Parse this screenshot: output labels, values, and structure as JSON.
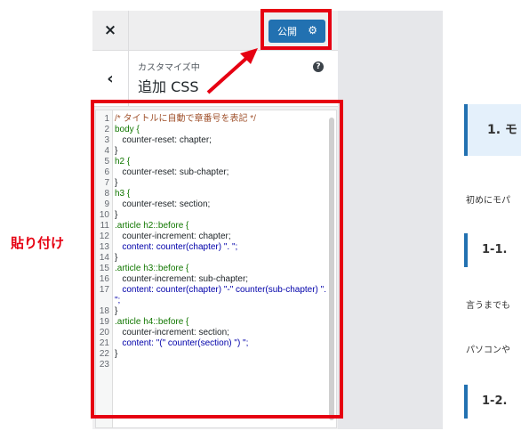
{
  "annotation": {
    "label": "貼り付け",
    "color": "#e60012"
  },
  "header": {
    "close_icon": "×",
    "publish_label": "公開",
    "settings_icon": "⚙"
  },
  "section": {
    "back_icon": "‹",
    "breadcrumb": "カスタマイズ中",
    "title": "追加 CSS",
    "help_icon": "?"
  },
  "editor": {
    "lines": [
      {
        "n": "1",
        "text": "/* タイトルに自動で章番号を表記 */",
        "type": "comment"
      },
      {
        "n": "2",
        "text": "body {",
        "type": "tag"
      },
      {
        "n": "3",
        "text": "   counter-reset: chapter;",
        "type": "plain"
      },
      {
        "n": "4",
        "text": "}",
        "type": "plain"
      },
      {
        "n": "5",
        "text": "h2 {",
        "type": "tag"
      },
      {
        "n": "6",
        "text": "   counter-reset: sub-chapter;",
        "type": "plain"
      },
      {
        "n": "7",
        "text": "}",
        "type": "plain"
      },
      {
        "n": "8",
        "text": "h3 {",
        "type": "tag"
      },
      {
        "n": "9",
        "text": "   counter-reset: section;",
        "type": "plain"
      },
      {
        "n": "10",
        "text": "}",
        "type": "plain"
      },
      {
        "n": "11",
        "text": ".article h2::before {",
        "type": "tag"
      },
      {
        "n": "12",
        "text": "   counter-increment: chapter;",
        "type": "plain"
      },
      {
        "n": "13",
        "text": "   content: counter(chapter) \". \";",
        "type": "fn"
      },
      {
        "n": "14",
        "text": "}",
        "type": "plain"
      },
      {
        "n": "15",
        "text": ".article h3::before {",
        "type": "tag"
      },
      {
        "n": "16",
        "text": "   counter-increment: sub-chapter;",
        "type": "plain"
      },
      {
        "n": "17",
        "text": "   content: counter(chapter) \"-\" counter(sub-chapter) \". \";",
        "type": "fn"
      },
      {
        "n": "18",
        "text": "}",
        "type": "plain"
      },
      {
        "n": "19",
        "text": ".article h4::before {",
        "type": "tag"
      },
      {
        "n": "20",
        "text": "   counter-increment: section;",
        "type": "plain"
      },
      {
        "n": "21",
        "text": "   content: \"(\" counter(section) \") \";",
        "type": "fn"
      },
      {
        "n": "22",
        "text": "}",
        "type": "plain"
      },
      {
        "n": "23",
        "text": "",
        "type": "plain"
      }
    ]
  },
  "preview": {
    "heading_1": "1. モ",
    "text_1": "初めにモパ",
    "heading_1_1": "1-1.",
    "text_2": "言うまでも",
    "text_3": "パソコンや",
    "heading_1_2": "1-2."
  },
  "colors": {
    "accent": "#2271b1",
    "highlight": "#e60012"
  }
}
